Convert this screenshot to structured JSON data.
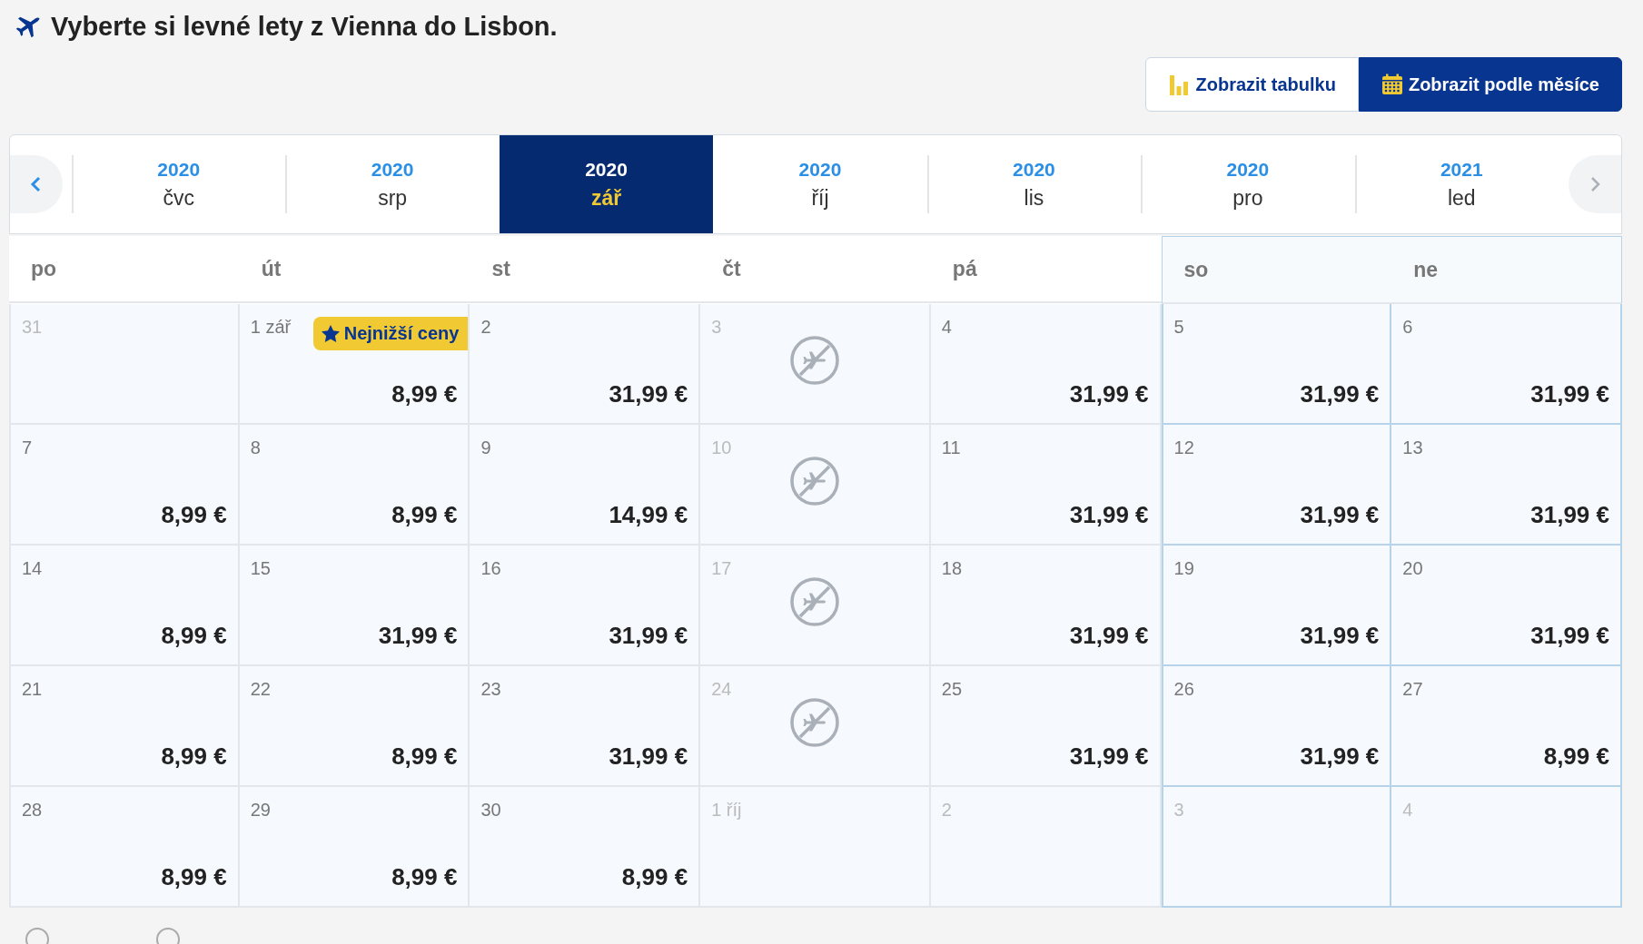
{
  "title": "Vyberte si levné lety z Vienna do Lisbon.",
  "view_buttons": [
    {
      "kind": "chart",
      "label": "Zobrazit tabulku",
      "selected": false
    },
    {
      "kind": "calendar",
      "label": "Zobrazit podle měsíce",
      "selected": true
    }
  ],
  "months": [
    {
      "year": "2020",
      "month": "čvc",
      "selected": false
    },
    {
      "year": "2020",
      "month": "srp",
      "selected": false
    },
    {
      "year": "2020",
      "month": "zář",
      "selected": true
    },
    {
      "year": "2020",
      "month": "říj",
      "selected": false
    },
    {
      "year": "2020",
      "month": "lis",
      "selected": false
    },
    {
      "year": "2020",
      "month": "pro",
      "selected": false
    },
    {
      "year": "2021",
      "month": "led",
      "selected": false
    }
  ],
  "weekdays": [
    {
      "label": "po",
      "weekend": false
    },
    {
      "label": "út",
      "weekend": false
    },
    {
      "label": "st",
      "weekend": false
    },
    {
      "label": "čt",
      "weekend": false
    },
    {
      "label": "pá",
      "weekend": false
    },
    {
      "label": "so",
      "weekend": true
    },
    {
      "label": "ne",
      "weekend": true
    }
  ],
  "weeks": [
    [
      {
        "kind": "empty",
        "day": "31",
        "muted": true
      },
      {
        "kind": "price",
        "day": "1 zář",
        "muted": false,
        "price": "8,99 €",
        "badge": "Nejnižší ceny"
      },
      {
        "kind": "price",
        "day": "2",
        "muted": false,
        "price": "31,99 €"
      },
      {
        "kind": "no-flight",
        "day": "3",
        "muted": true
      },
      {
        "kind": "price",
        "day": "4",
        "muted": false,
        "price": "31,99 €"
      },
      {
        "kind": "price",
        "day": "5",
        "muted": false,
        "price": "31,99 €"
      },
      {
        "kind": "price",
        "day": "6",
        "muted": false,
        "price": "31,99 €"
      }
    ],
    [
      {
        "kind": "price",
        "day": "7",
        "muted": false,
        "price": "8,99 €"
      },
      {
        "kind": "price",
        "day": "8",
        "muted": false,
        "price": "8,99 €"
      },
      {
        "kind": "price",
        "day": "9",
        "muted": false,
        "price": "14,99 €"
      },
      {
        "kind": "no-flight",
        "day": "10",
        "muted": true
      },
      {
        "kind": "price",
        "day": "11",
        "muted": false,
        "price": "31,99 €"
      },
      {
        "kind": "price",
        "day": "12",
        "muted": false,
        "price": "31,99 €"
      },
      {
        "kind": "price",
        "day": "13",
        "muted": false,
        "price": "31,99 €"
      }
    ],
    [
      {
        "kind": "price",
        "day": "14",
        "muted": false,
        "price": "8,99 €"
      },
      {
        "kind": "price",
        "day": "15",
        "muted": false,
        "price": "31,99 €"
      },
      {
        "kind": "price",
        "day": "16",
        "muted": false,
        "price": "31,99 €"
      },
      {
        "kind": "no-flight",
        "day": "17",
        "muted": true
      },
      {
        "kind": "price",
        "day": "18",
        "muted": false,
        "price": "31,99 €"
      },
      {
        "kind": "price",
        "day": "19",
        "muted": false,
        "price": "31,99 €"
      },
      {
        "kind": "price",
        "day": "20",
        "muted": false,
        "price": "31,99 €"
      }
    ],
    [
      {
        "kind": "price",
        "day": "21",
        "muted": false,
        "price": "8,99 €"
      },
      {
        "kind": "price",
        "day": "22",
        "muted": false,
        "price": "8,99 €"
      },
      {
        "kind": "price",
        "day": "23",
        "muted": false,
        "price": "31,99 €"
      },
      {
        "kind": "no-flight",
        "day": "24",
        "muted": true
      },
      {
        "kind": "price",
        "day": "25",
        "muted": false,
        "price": "31,99 €"
      },
      {
        "kind": "price",
        "day": "26",
        "muted": false,
        "price": "31,99 €"
      },
      {
        "kind": "price",
        "day": "27",
        "muted": false,
        "price": "8,99 €"
      }
    ],
    [
      {
        "kind": "price",
        "day": "28",
        "muted": false,
        "price": "8,99 €"
      },
      {
        "kind": "price",
        "day": "29",
        "muted": false,
        "price": "8,99 €"
      },
      {
        "kind": "price",
        "day": "30",
        "muted": false,
        "price": "8,99 €"
      },
      {
        "kind": "empty",
        "day": "1 říj",
        "muted": true
      },
      {
        "kind": "empty",
        "day": "2",
        "muted": true
      },
      {
        "kind": "empty",
        "day": "3",
        "muted": true
      },
      {
        "kind": "empty",
        "day": "4",
        "muted": true
      }
    ]
  ]
}
